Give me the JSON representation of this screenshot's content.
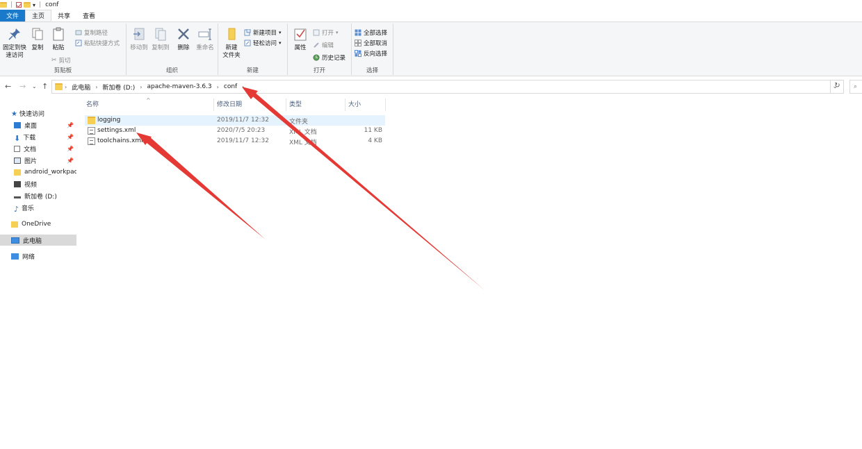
{
  "window": {
    "title": "conf"
  },
  "tabs": {
    "file": "文件",
    "home": "主页",
    "share": "共享",
    "view": "查看"
  },
  "ribbon": {
    "clipboard": {
      "label": "剪贴板",
      "pin_quick": "固定到快\n速访问",
      "copy": "复制",
      "paste": "粘贴",
      "copy_path": "复制路径",
      "paste_shortcut": "粘贴快捷方式",
      "cut": "剪切"
    },
    "organize": {
      "label": "组织",
      "move_to": "移动到",
      "copy_to": "复制到",
      "delete": "删除",
      "rename": "重命名"
    },
    "new": {
      "label": "新建",
      "new_folder": "新建\n文件夹",
      "new_item": "新建项目",
      "easy_access": "轻松访问"
    },
    "open": {
      "label": "打开",
      "properties": "属性",
      "open": "打开",
      "edit": "编辑",
      "history": "历史记录"
    },
    "select": {
      "label": "选择",
      "select_all": "全部选择",
      "select_none": "全部取消",
      "invert": "反向选择"
    }
  },
  "address": {
    "crumbs": [
      "此电脑",
      "新加卷 (D:)",
      "apache-maven-3.6.3",
      "conf"
    ],
    "search_placeholder": "⌕"
  },
  "sidebar": {
    "items": [
      {
        "label": "快速访问",
        "icon": "star-icon"
      },
      {
        "label": "桌面",
        "icon": "desktop-icon",
        "pinned": true
      },
      {
        "label": "下载",
        "icon": "download-icon",
        "pinned": true
      },
      {
        "label": "文档",
        "icon": "document-icon",
        "pinned": true
      },
      {
        "label": "图片",
        "icon": "picture-icon",
        "pinned": true
      },
      {
        "label": "android_workpace",
        "icon": "folder-icon"
      },
      {
        "label": "视频",
        "icon": "video-icon"
      },
      {
        "label": "新加卷 (D:)",
        "icon": "drive-icon"
      },
      {
        "label": "音乐",
        "icon": "music-icon"
      },
      {
        "label": "OneDrive",
        "icon": "folder-icon"
      },
      {
        "label": "此电脑",
        "icon": "computer-icon"
      },
      {
        "label": "网络",
        "icon": "network-icon"
      }
    ]
  },
  "list": {
    "columns": {
      "name": "名称",
      "date": "修改日期",
      "type": "类型",
      "size": "大小"
    },
    "rows": [
      {
        "name": "logging",
        "date": "2019/11/7 12:32",
        "type": "文件夹",
        "size": "",
        "icon": "folder-icon"
      },
      {
        "name": "settings.xml",
        "date": "2020/7/5 20:23",
        "type": "XML 文档",
        "size": "11 KB",
        "icon": "xml-file-icon"
      },
      {
        "name": "toolchains.xml",
        "date": "2019/11/7 12:32",
        "type": "XML 文档",
        "size": "4 KB",
        "icon": "xml-file-icon"
      }
    ]
  },
  "colors": {
    "accent": "#1979ca",
    "annotation": "#e53935",
    "selected_nav": "#d9d9d9",
    "hover_row": "#e5f3ff"
  }
}
